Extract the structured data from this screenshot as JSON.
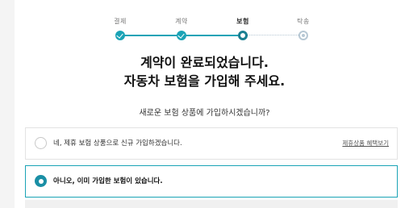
{
  "stepper": {
    "steps": [
      {
        "label": "결제",
        "state": "done"
      },
      {
        "label": "계약",
        "state": "done"
      },
      {
        "label": "보험",
        "state": "current"
      },
      {
        "label": "탁송",
        "state": "pending"
      }
    ],
    "accent_color": "#1aa3b6"
  },
  "headline": {
    "line1": "계약이 완료되었습니다.",
    "line2": "자동차 보험을 가입해 주세요."
  },
  "question": "새로운 보험 상품에 가입하시겠습니까?",
  "options": [
    {
      "label": "네, 제휴 보험 상품으로 신규 가입하겠습니다.",
      "link": "제휴상품 혜택보기",
      "selected": false
    },
    {
      "label": "아니오, 이미 가입한 보험이 있습니다.",
      "selected": true
    }
  ]
}
